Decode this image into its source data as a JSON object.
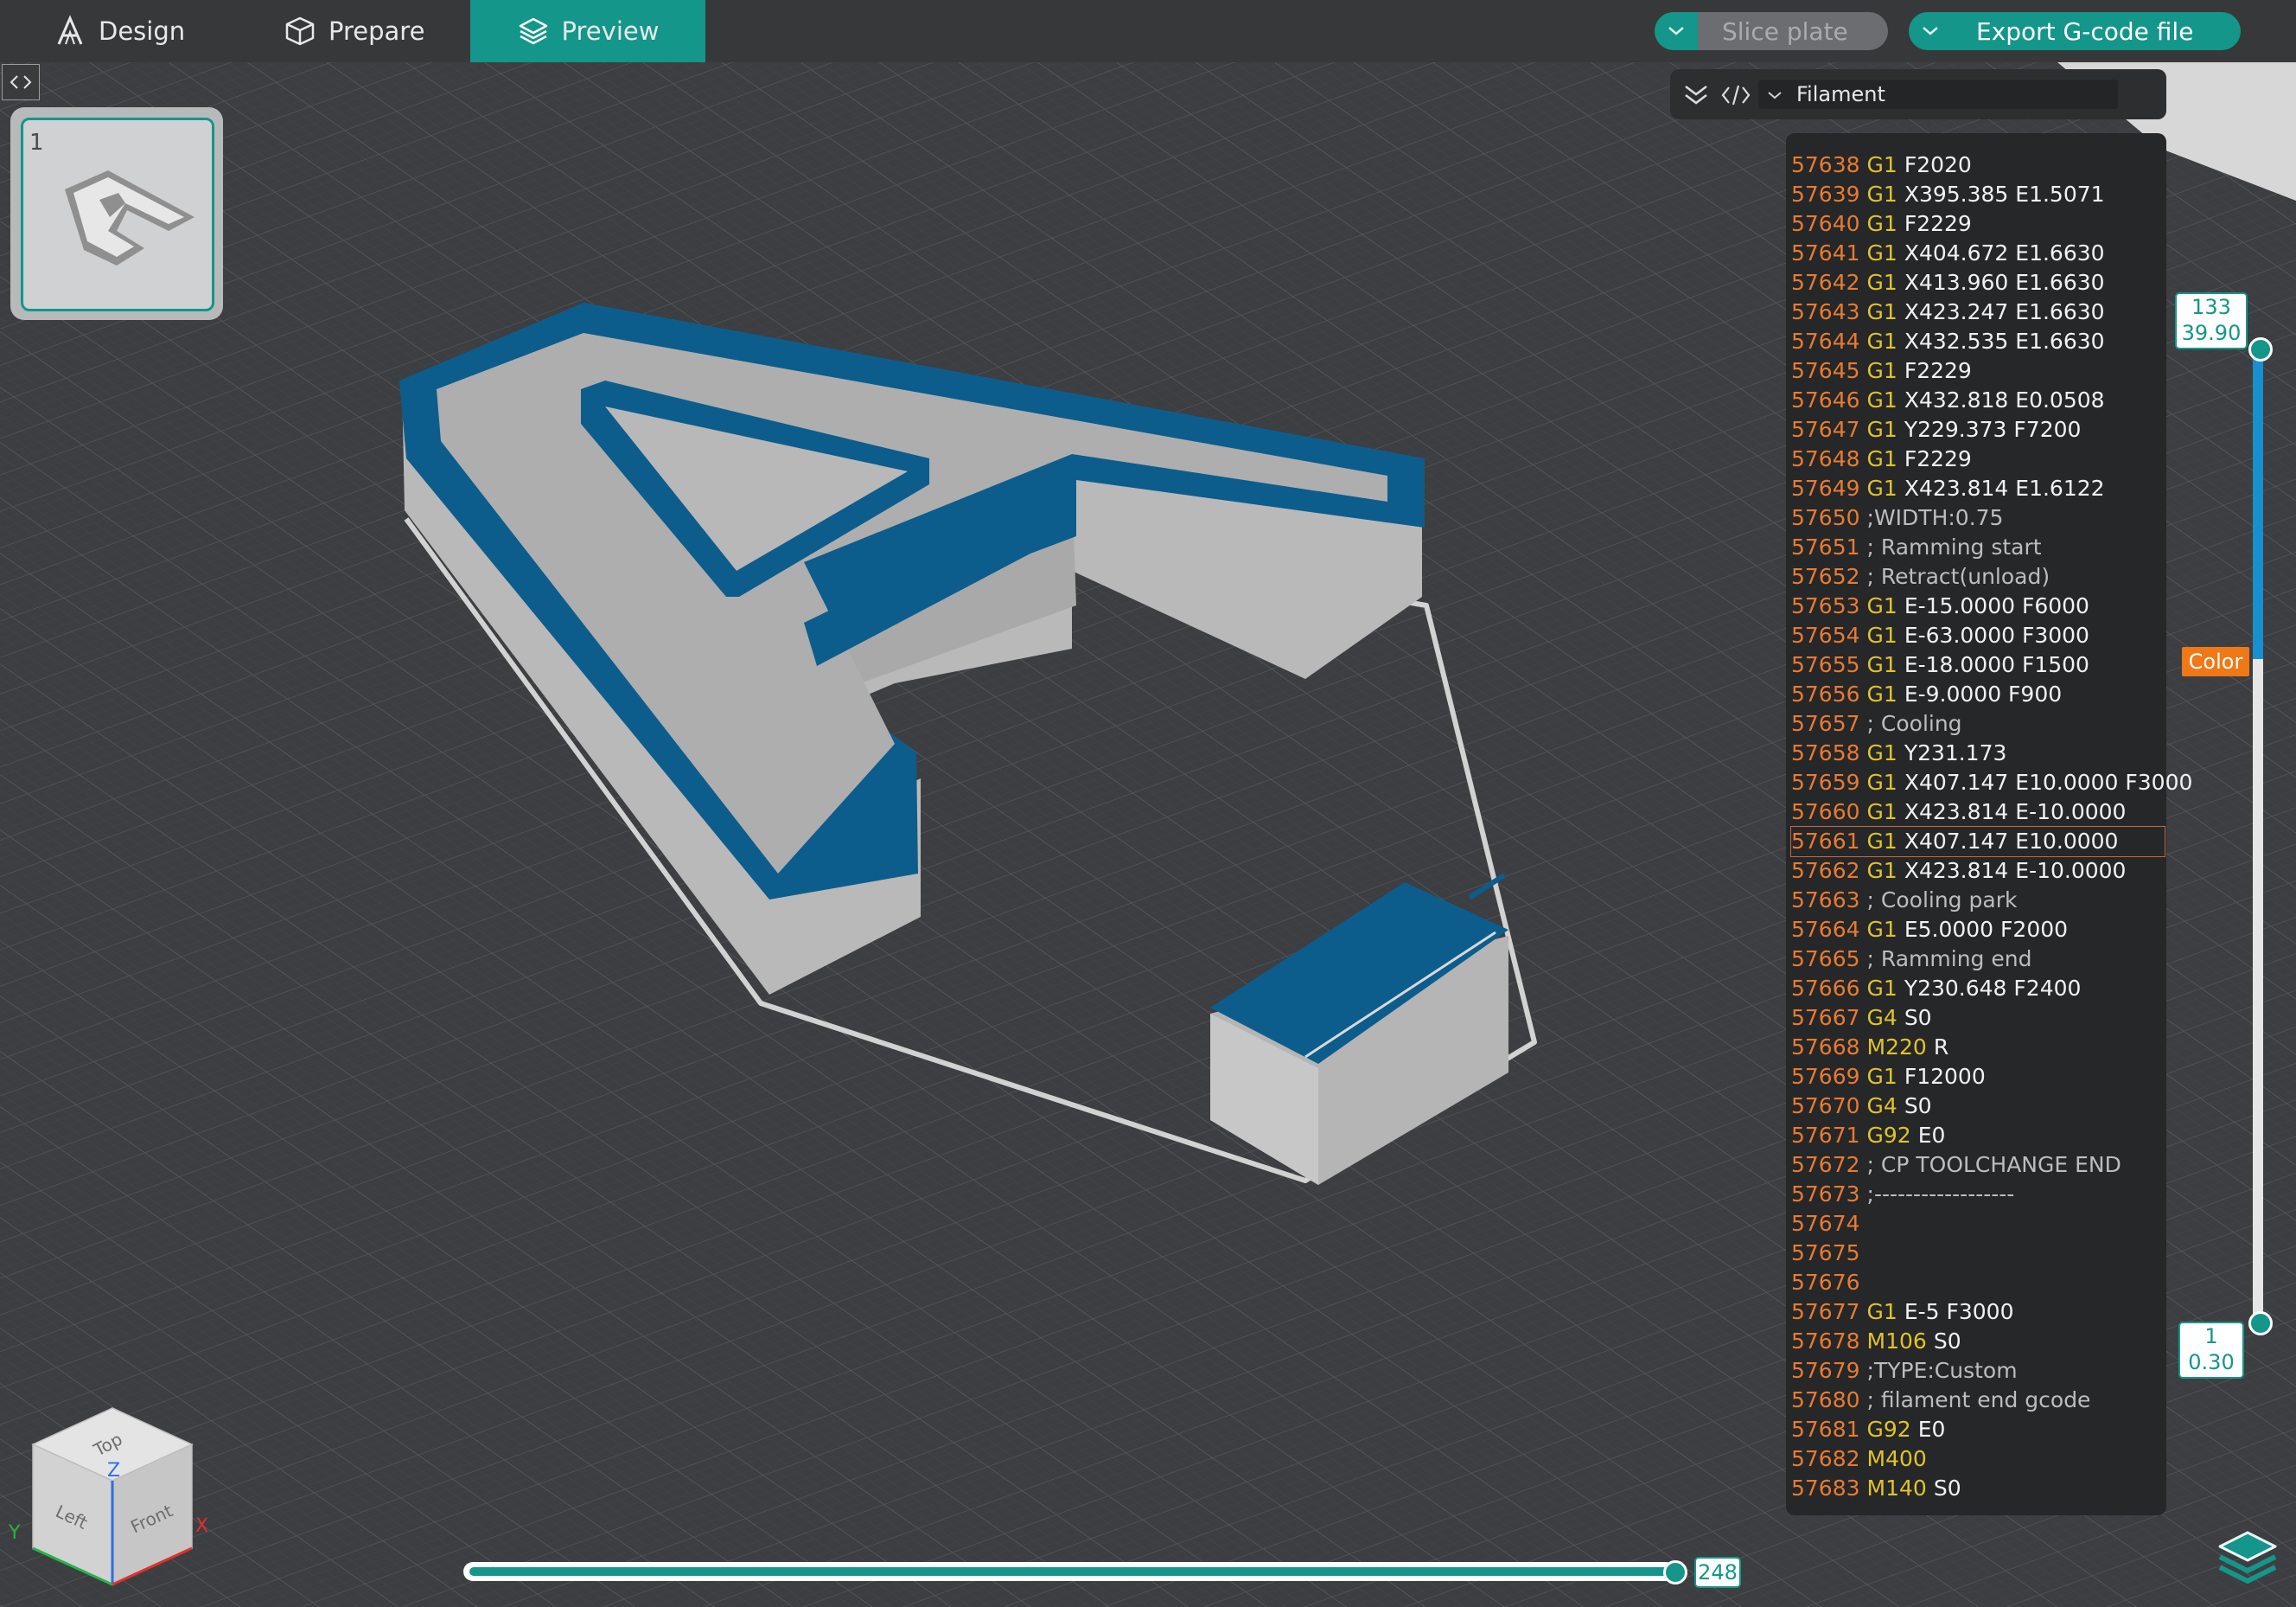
{
  "topbar": {
    "tabs": [
      {
        "label": "Design",
        "icon": "design-logo-icon"
      },
      {
        "label": "Prepare",
        "icon": "cube-icon"
      },
      {
        "label": "Preview",
        "icon": "layers-icon",
        "active": true
      }
    ],
    "slice_label": "Slice plate",
    "export_label": "Export G-code file"
  },
  "plate": {
    "number": "1"
  },
  "gcode_viewer": {
    "selector_value": "Filament",
    "lines": [
      {
        "n": "57638",
        "cmd": "G1",
        "args": "F2020"
      },
      {
        "n": "57639",
        "cmd": "G1",
        "args": "X395.385 E1.5071"
      },
      {
        "n": "57640",
        "cmd": "G1",
        "args": "F2229"
      },
      {
        "n": "57641",
        "cmd": "G1",
        "args": "X404.672 E1.6630"
      },
      {
        "n": "57642",
        "cmd": "G1",
        "args": "X413.960 E1.6630"
      },
      {
        "n": "57643",
        "cmd": "G1",
        "args": "X423.247 E1.6630"
      },
      {
        "n": "57644",
        "cmd": "G1",
        "args": "X432.535 E1.6630"
      },
      {
        "n": "57645",
        "cmd": "G1",
        "args": "F2229"
      },
      {
        "n": "57646",
        "cmd": "G1",
        "args": "X432.818 E0.0508"
      },
      {
        "n": "57647",
        "cmd": "G1",
        "args": "Y229.373 F7200"
      },
      {
        "n": "57648",
        "cmd": "G1",
        "args": "F2229"
      },
      {
        "n": "57649",
        "cmd": "G1",
        "args": "X423.814 E1.6122"
      },
      {
        "n": "57650",
        "cmd": "",
        "args": ";WIDTH:0.75"
      },
      {
        "n": "57651",
        "cmd": "",
        "args": "; Ramming start"
      },
      {
        "n": "57652",
        "cmd": "",
        "args": "; Retract(unload)"
      },
      {
        "n": "57653",
        "cmd": "G1",
        "args": "E-15.0000 F6000"
      },
      {
        "n": "57654",
        "cmd": "G1",
        "args": "E-63.0000 F3000"
      },
      {
        "n": "57655",
        "cmd": "G1",
        "args": "E-18.0000 F1500"
      },
      {
        "n": "57656",
        "cmd": "G1",
        "args": "E-9.0000 F900"
      },
      {
        "n": "57657",
        "cmd": "",
        "args": "; Cooling"
      },
      {
        "n": "57658",
        "cmd": "G1",
        "args": "Y231.173"
      },
      {
        "n": "57659",
        "cmd": "G1",
        "args": "X407.147 E10.0000 F3000"
      },
      {
        "n": "57660",
        "cmd": "G1",
        "args": "X423.814 E-10.0000"
      },
      {
        "n": "57661",
        "cmd": "G1",
        "args": "X407.147 E10.0000",
        "selected": true
      },
      {
        "n": "57662",
        "cmd": "G1",
        "args": "X423.814 E-10.0000"
      },
      {
        "n": "57663",
        "cmd": "",
        "args": "; Cooling park"
      },
      {
        "n": "57664",
        "cmd": "G1",
        "args": "E5.0000 F2000"
      },
      {
        "n": "57665",
        "cmd": "",
        "args": "; Ramming end"
      },
      {
        "n": "57666",
        "cmd": "G1",
        "args": "Y230.648 F2400"
      },
      {
        "n": "57667",
        "cmd": "G4",
        "args": "S0"
      },
      {
        "n": "57668",
        "cmd": "M220",
        "args": "R"
      },
      {
        "n": "57669",
        "cmd": "G1",
        "args": "F12000"
      },
      {
        "n": "57670",
        "cmd": "G4",
        "args": "S0"
      },
      {
        "n": "57671",
        "cmd": "G92",
        "args": "E0"
      },
      {
        "n": "57672",
        "cmd": "",
        "args": "; CP TOOLCHANGE END"
      },
      {
        "n": "57673",
        "cmd": "",
        "args": ";------------------"
      },
      {
        "n": "57674",
        "cmd": "",
        "args": ""
      },
      {
        "n": "57675",
        "cmd": "",
        "args": ""
      },
      {
        "n": "57676",
        "cmd": "",
        "args": ""
      },
      {
        "n": "57677",
        "cmd": "G1",
        "args": "E-5 F3000"
      },
      {
        "n": "57678",
        "cmd": "M106",
        "args": "S0"
      },
      {
        "n": "57679",
        "cmd": "",
        "args": ";TYPE:Custom"
      },
      {
        "n": "57680",
        "cmd": "",
        "args": "; filament end gcode"
      },
      {
        "n": "57681",
        "cmd": "G92",
        "args": "E0"
      },
      {
        "n": "57682",
        "cmd": "M400",
        "args": ""
      },
      {
        "n": "57683",
        "cmd": "M140",
        "args": "S0"
      }
    ]
  },
  "layer_slider": {
    "top_layer": "133",
    "top_height": "39.90",
    "bottom_layer": "1",
    "bottom_height": "0.30",
    "color_label": "Color",
    "colors": {
      "accent": "#14968a",
      "layer_fill": "#1a8fd0",
      "badge": "#f07816"
    }
  },
  "move_slider": {
    "value": "248",
    "fraction": 1.0
  },
  "view_cube": {
    "top": "Top",
    "left": "Left",
    "front": "Front",
    "axis_x": "X",
    "axis_y": "Y",
    "axis_z": "Z"
  }
}
